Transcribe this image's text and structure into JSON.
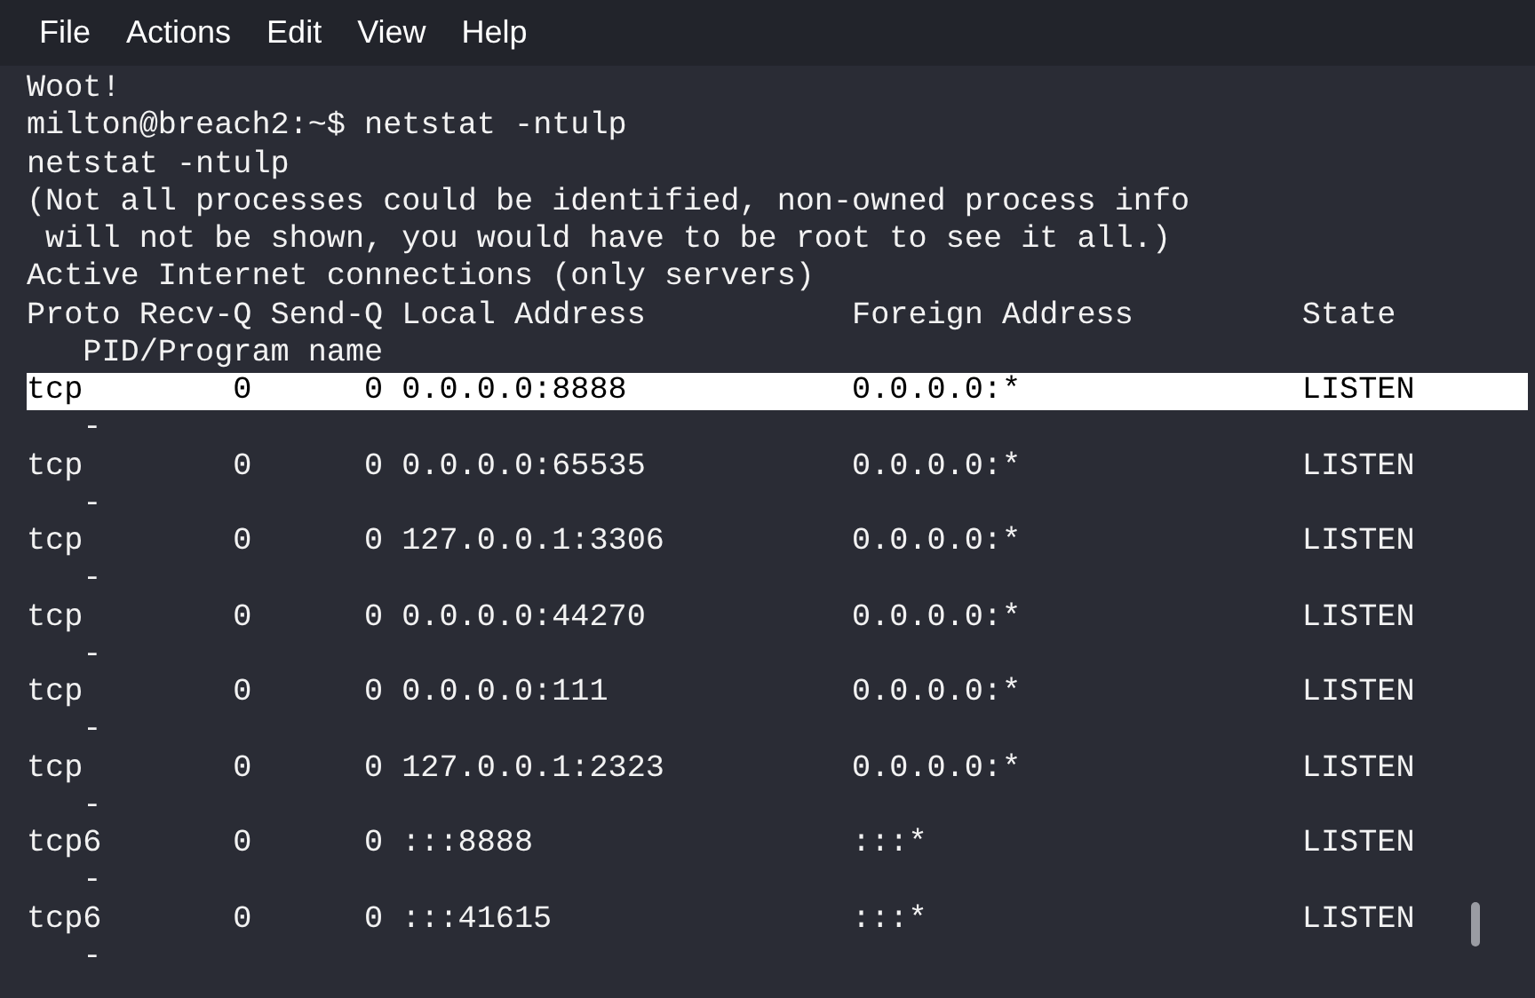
{
  "menu_bar": [
    "File",
    "Actions",
    "Edit",
    "View",
    "Help"
  ],
  "terminal": {
    "lines": [
      "Woot!",
      "milton@breach2:~$ netstat -ntulp",
      "netstat -ntulp",
      "(Not all processes could be identified, non-owned process info",
      " will not be shown, you would have to be root to see it all.)",
      "Active Internet connections (only servers)"
    ],
    "table": {
      "columns": [
        "Proto",
        "Recv-Q",
        "Send-Q",
        "Local Address",
        "Foreign Address",
        "State",
        "PID/Program name"
      ],
      "rows": [
        {
          "proto": "tcp",
          "recv_q": "0",
          "send_q": "0",
          "local": "0.0.0.0:8888",
          "foreign": "0.0.0.0:*",
          "state": "LISTEN",
          "program": "-",
          "selected": true
        },
        {
          "proto": "tcp",
          "recv_q": "0",
          "send_q": "0",
          "local": "0.0.0.0:65535",
          "foreign": "0.0.0.0:*",
          "state": "LISTEN",
          "program": "-",
          "selected": false
        },
        {
          "proto": "tcp",
          "recv_q": "0",
          "send_q": "0",
          "local": "127.0.0.1:3306",
          "foreign": "0.0.0.0:*",
          "state": "LISTEN",
          "program": "-",
          "selected": false
        },
        {
          "proto": "tcp",
          "recv_q": "0",
          "send_q": "0",
          "local": "0.0.0.0:44270",
          "foreign": "0.0.0.0:*",
          "state": "LISTEN",
          "program": "-",
          "selected": false
        },
        {
          "proto": "tcp",
          "recv_q": "0",
          "send_q": "0",
          "local": "0.0.0.0:111",
          "foreign": "0.0.0.0:*",
          "state": "LISTEN",
          "program": "-",
          "selected": false
        },
        {
          "proto": "tcp",
          "recv_q": "0",
          "send_q": "0",
          "local": "127.0.0.1:2323",
          "foreign": "0.0.0.0:*",
          "state": "LISTEN",
          "program": "-",
          "selected": false
        },
        {
          "proto": "tcp6",
          "recv_q": "0",
          "send_q": "0",
          "local": ":::8888",
          "foreign": ":::*",
          "state": "LISTEN",
          "program": "-",
          "selected": false
        },
        {
          "proto": "tcp6",
          "recv_q": "0",
          "send_q": "0",
          "local": ":::41615",
          "foreign": ":::*",
          "state": "LISTEN",
          "program": "-",
          "selected": false
        }
      ]
    }
  }
}
